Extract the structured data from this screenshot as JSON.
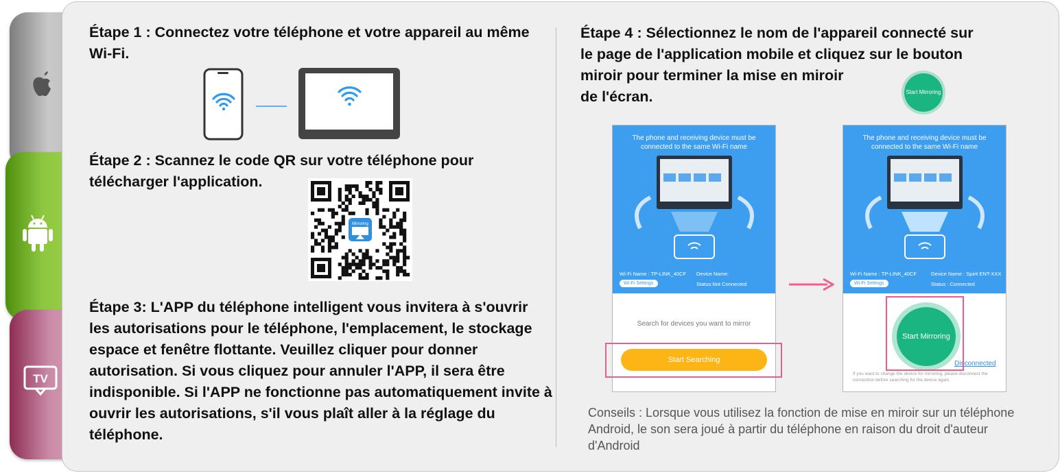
{
  "side_tabs": {
    "apple_icon": "apple-logo",
    "android_icon": "android-robot",
    "tv_label": "TV"
  },
  "step1": {
    "text": "Étape 1 : Connectez votre téléphone et votre appareil au même Wi-Fi."
  },
  "step2": {
    "text": "Étape 2 : Scannez le code QR sur votre téléphone pour télécharger l'application.",
    "qr_logo_label": "Mirroring"
  },
  "step3": {
    "text": "Étape 3: L'APP du téléphone intelligent vous invitera à s'ouvrir les autorisations pour le téléphone, l'emplacement, le stockage espace et fenêtre flottante. Veuillez cliquer pour donner autorisation. Si vous cliquez pour annuler l'APP, il sera être indisponible. Si l'APP ne fonctionne pas automatiquement invite à ouvrir les autorisations, s'il vous plaît aller à la réglage du téléphone."
  },
  "step4": {
    "line1": "Étape 4 : Sélectionnez le nom de l'appareil connecté sur",
    "line2": "le page de l'application mobile et cliquez sur le bouton",
    "line3": "miroir pour terminer la mise en miroir",
    "line4": "de l'écran.",
    "badge": "Start Mirroring"
  },
  "screen_left": {
    "header": "The phone and receiving device must be connected to the same Wi-Fi name",
    "wifi_name": "Wi-Fi Name : TP-LINK_40CF",
    "device_name": "Device Name:",
    "wifi_settings": "Wi-Fi Settings",
    "status": "Status:Not Connected",
    "search_text": "Search for devices you want to mirror",
    "button": "Start Searching"
  },
  "screen_right": {
    "header": "The phone and receiving device must be connected to the same Wi-Fi name",
    "wifi_name": "Wi-Fi Name : TP-LINK_40CF",
    "device_name": "Device Name : Spirit ENT-XXX",
    "wifi_settings": "Wi-Fi Settings",
    "status": "Status : Connected",
    "button": "Start Mirroring",
    "disconnect": "Disconnected",
    "note": "If you want to change the device for mirroring, please disconnect the connection before searching for the device again."
  },
  "tips": "Conseils : Lorsque vous utilisez la fonction de mise en miroir sur un téléphone Android, le son sera joué à partir du téléphone en raison du droit d'auteur d'Android",
  "colors": {
    "panel_bg": "#efefef",
    "app_blue": "#3d9ef0",
    "start_yellow": "#fdb515",
    "mirror_green": "#1ab580",
    "highlight_pink": "#f05a92",
    "arrow_pink": "#f0608f"
  }
}
